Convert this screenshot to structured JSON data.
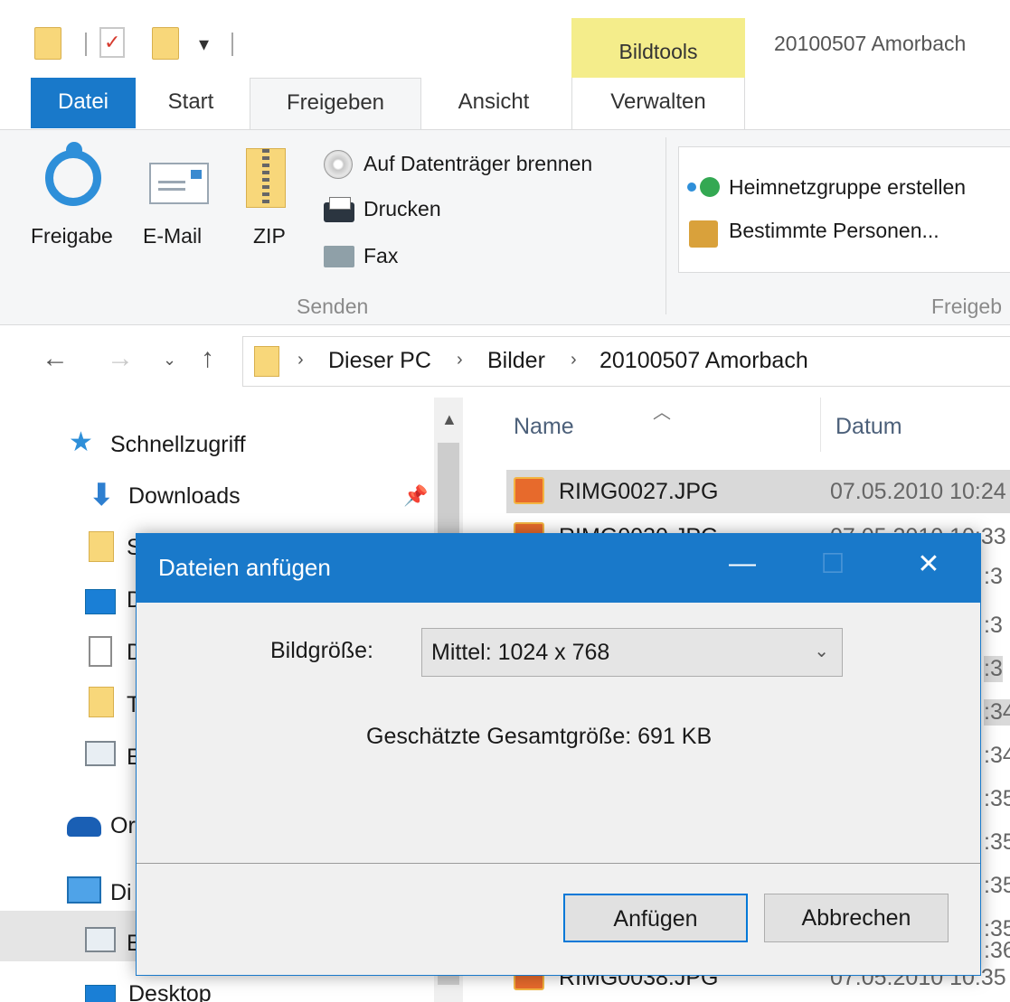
{
  "window": {
    "context_tab": "Bildtools",
    "title": "20100507 Amorbach"
  },
  "ribbon_tabs": [
    "Datei",
    "Start",
    "Freigeben",
    "Ansicht",
    "Verwalten"
  ],
  "ribbon": {
    "freigabe_label": "Freigabe",
    "email_label": "E-Mail",
    "zip_label": "ZIP",
    "burn_label": "Auf Datenträger brennen",
    "print_label": "Drucken",
    "fax_label": "Fax",
    "send_group": "Senden",
    "homegroup_label": "Heimnetzgruppe erstellen",
    "specific_people_label": "Bestimmte Personen...",
    "share_group": "Freigeb"
  },
  "address": {
    "crumbs": [
      "Dieser PC",
      "Bilder",
      "20100507 Amorbach"
    ]
  },
  "nav": {
    "quick_access": "Schnellzugriff",
    "downloads": "Downloads",
    "partial_letters": [
      "S",
      "D",
      "D",
      "T",
      "E",
      "Or",
      "Di",
      "E"
    ],
    "desktop": "Desktop"
  },
  "filelist": {
    "col_name": "Name",
    "col_date": "Datum",
    "rows": [
      {
        "name": "RIMG0027.JPG",
        "date": "07.05.2010 10:24"
      },
      {
        "name": "RIMG0030.JPG",
        "date": "07.05.2010 10:33"
      },
      {
        "name": "RIMG0038.JPG",
        "date": "07.05.2010 10:35"
      }
    ],
    "time_fragments": [
      ":3",
      ":3",
      ":3",
      ":34",
      ":34",
      ":35",
      ":35",
      ":35",
      ":35",
      ":36"
    ]
  },
  "dialog": {
    "title": "Dateien anfügen",
    "minimize": "—",
    "maximize": "☐",
    "close": "✕",
    "size_label": "Bildgröße:",
    "size_value": "Mittel: 1024 x 768",
    "estimated": "Geschätzte Gesamtgröße: 691 KB",
    "attach_button": "Anfügen",
    "cancel_button": "Abbrechen"
  },
  "colors": {
    "accent": "#1979ca",
    "bildtools": "#f4ed8b",
    "folder": "#f8d77a"
  }
}
